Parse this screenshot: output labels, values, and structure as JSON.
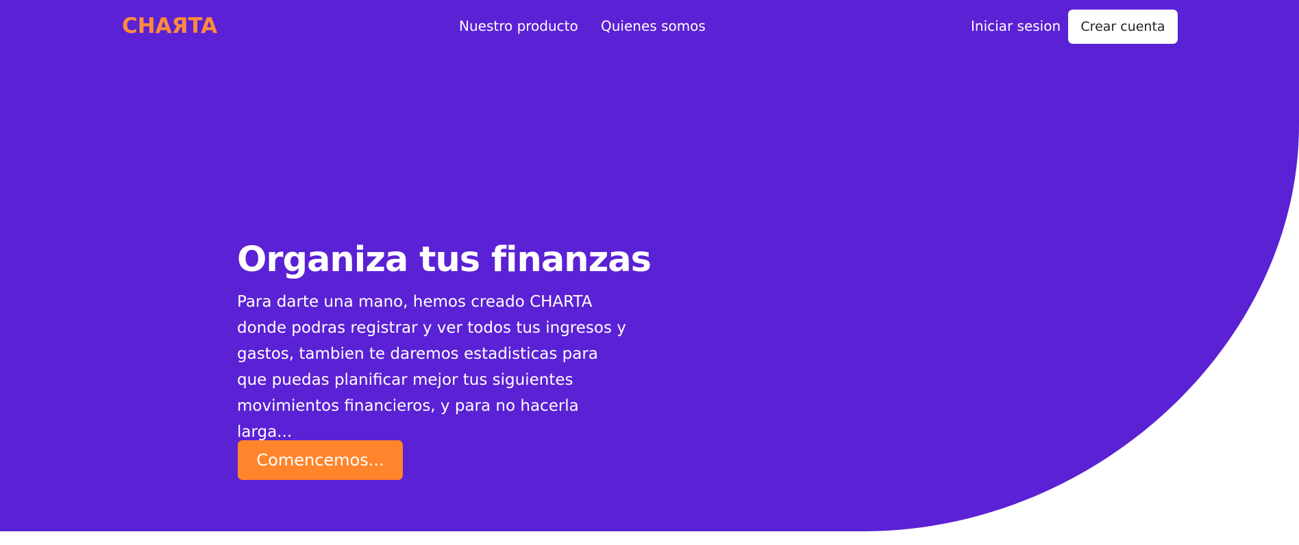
{
  "brand": {
    "logo_text": "CHAЯTA"
  },
  "navigation": {
    "links": [
      {
        "label": "Nuestro producto"
      },
      {
        "label": "Quienes somos"
      }
    ],
    "login_label": "Iniciar sesion",
    "signup_label": "Crear cuenta"
  },
  "hero": {
    "title": "Organiza tus finanzas",
    "description": "Para darte una mano, hemos creado CHARTA donde podras registrar y ver todos tus ingresos y gastos, tambien te daremos estadisticas para que puedas planificar mejor tus siguientes movimientos financieros, y para no hacerla larga...",
    "cta_label": "Comencemos..."
  },
  "colors": {
    "hero_background": "#5b21d4",
    "brand_accent": "#ff8a3d",
    "cta_background": "#ff842b",
    "page_background": "#ffffff"
  }
}
